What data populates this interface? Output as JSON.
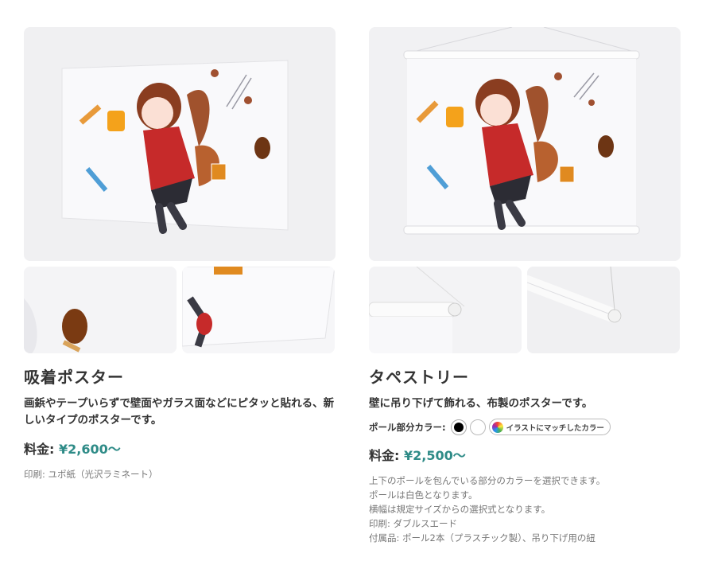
{
  "products": [
    {
      "title": "吸着ポスター",
      "description": "画鋲やテープいらずで壁面やガラス面などにピタッと貼れる、新しいタイプのポスターです。",
      "price_label": "料金:",
      "price_value": "¥2,600〜",
      "notes": [
        "印刷: ユポ紙（光沢ラミネート）"
      ]
    },
    {
      "title": "タペストリー",
      "description": "壁に吊り下げて飾れる、布製のポスターです。",
      "color_label": "ポール部分カラー:",
      "color_options": [
        "black",
        "white"
      ],
      "match_label": "イラストにマッチしたカラー",
      "price_label": "料金:",
      "price_value": "¥2,500〜",
      "notes": [
        "上下のポールを包んでいる部分のカラーを選択できます。",
        "ポールは白色となります。",
        "横幅は規定サイズからの選択式となります。",
        "印刷: ダブルスエード",
        "付属品: ポール2本（プラスチック製）、吊り下げ用の紐"
      ]
    }
  ],
  "colors": {
    "accent": "#2e8b87",
    "text": "#333333",
    "muted": "#777777"
  }
}
